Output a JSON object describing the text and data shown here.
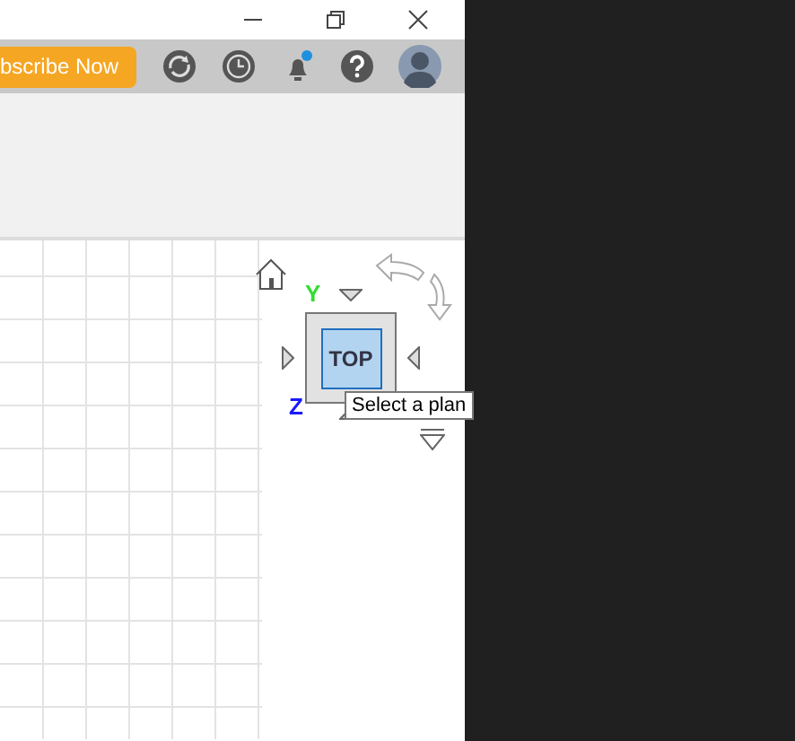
{
  "window": {
    "controls": [
      {
        "kind": "minimize"
      },
      {
        "kind": "restore"
      },
      {
        "kind": "close"
      }
    ]
  },
  "toolbar": {
    "subscribe_button": "bscribe Now",
    "icons": [
      {
        "kind": "sync"
      },
      {
        "kind": "history"
      },
      {
        "kind": "notifications",
        "badge": true
      },
      {
        "kind": "help"
      },
      {
        "kind": "avatar"
      }
    ]
  },
  "viewcube": {
    "face": "TOP",
    "axes": [
      {
        "label": "Y",
        "color": "#33dd33"
      },
      {
        "label": "Z",
        "color": "#1a1aff"
      }
    ],
    "tooltip": "Select a plan"
  }
}
